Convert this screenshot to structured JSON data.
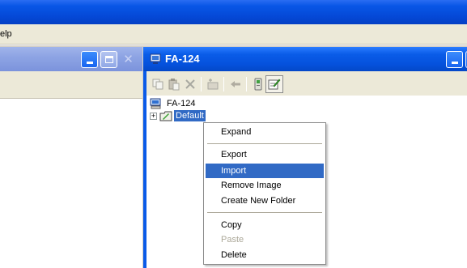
{
  "menubar": {
    "help_label": "elp"
  },
  "right_window": {
    "title": "FA-124"
  },
  "tree": {
    "root_label": "FA-124",
    "child_label": "Default",
    "expander": "+"
  },
  "context_menu": {
    "items": [
      {
        "label": "Expand",
        "state": "normal"
      },
      {
        "label": "Export",
        "state": "normal"
      },
      {
        "label": "Import",
        "state": "highlighted"
      },
      {
        "label": "Remove Image",
        "state": "normal"
      },
      {
        "label": "Create New Folder",
        "state": "normal"
      },
      {
        "label": "Copy",
        "state": "normal"
      },
      {
        "label": "Paste",
        "state": "disabled"
      },
      {
        "label": "Delete",
        "state": "normal"
      }
    ]
  },
  "icons": {
    "left_caption": [
      "minimize-icon",
      "maximize-icon",
      "close-icon"
    ],
    "right_caption": [
      "minimize-icon",
      "maximize-icon"
    ],
    "toolbar": [
      "copy-icon",
      "paste-icon",
      "delete-x-icon",
      "new-folder-icon",
      "back-arrow-icon",
      "device-icon",
      "properties-icon"
    ]
  },
  "colors": {
    "title_active": "#0a5ce8",
    "title_inactive": "#8ea4e4",
    "menu_highlight": "#316ac5",
    "disabled_text": "#aca899",
    "chrome": "#ece9d8"
  }
}
